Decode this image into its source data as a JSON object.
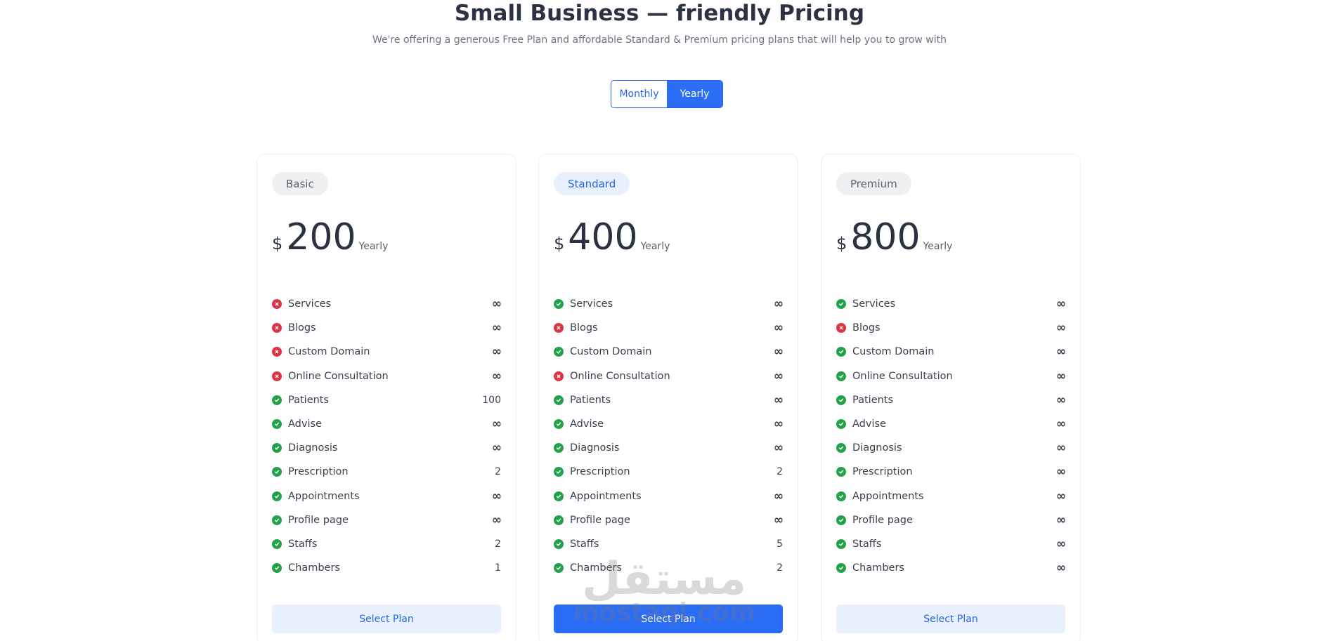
{
  "header": {
    "title": "Small Business — friendly Pricing",
    "subtitle": "We're offering a generous Free Plan and affordable Standard & Premium pricing plans that will help you to grow with"
  },
  "billing_toggle": {
    "options": [
      {
        "label": "Monthly",
        "selected": false
      },
      {
        "label": "Yearly",
        "selected": true
      }
    ]
  },
  "colors": {
    "accent": "#2b6df5",
    "check": "#22a24a",
    "cross": "#dc3545"
  },
  "icons": {
    "included": "check-circle-icon",
    "excluded": "x-circle-icon"
  },
  "plans": [
    {
      "name": "Basic",
      "currency": "$",
      "price": "200",
      "period": "Yearly",
      "button_label": "Select Plan",
      "features": [
        {
          "name": "Services",
          "included": false,
          "value": "∞"
        },
        {
          "name": "Blogs",
          "included": false,
          "value": "∞"
        },
        {
          "name": "Custom Domain",
          "included": false,
          "value": "∞"
        },
        {
          "name": "Online Consultation",
          "included": false,
          "value": "∞"
        },
        {
          "name": "Patients",
          "included": true,
          "value": "100"
        },
        {
          "name": "Advise",
          "included": true,
          "value": "∞"
        },
        {
          "name": "Diagnosis",
          "included": true,
          "value": "∞"
        },
        {
          "name": "Prescription",
          "included": true,
          "value": "2"
        },
        {
          "name": "Appointments",
          "included": true,
          "value": "∞"
        },
        {
          "name": "Profile page",
          "included": true,
          "value": "∞"
        },
        {
          "name": "Staffs",
          "included": true,
          "value": "2"
        },
        {
          "name": "Chambers",
          "included": true,
          "value": "1"
        }
      ]
    },
    {
      "name": "Standard",
      "currency": "$",
      "price": "400",
      "period": "Yearly",
      "button_label": "Select Plan",
      "features": [
        {
          "name": "Services",
          "included": true,
          "value": "∞"
        },
        {
          "name": "Blogs",
          "included": false,
          "value": "∞"
        },
        {
          "name": "Custom Domain",
          "included": true,
          "value": "∞"
        },
        {
          "name": "Online Consultation",
          "included": false,
          "value": "∞"
        },
        {
          "name": "Patients",
          "included": true,
          "value": "∞"
        },
        {
          "name": "Advise",
          "included": true,
          "value": "∞"
        },
        {
          "name": "Diagnosis",
          "included": true,
          "value": "∞"
        },
        {
          "name": "Prescription",
          "included": true,
          "value": "2"
        },
        {
          "name": "Appointments",
          "included": true,
          "value": "∞"
        },
        {
          "name": "Profile page",
          "included": true,
          "value": "∞"
        },
        {
          "name": "Staffs",
          "included": true,
          "value": "5"
        },
        {
          "name": "Chambers",
          "included": true,
          "value": "2"
        }
      ]
    },
    {
      "name": "Premium",
      "currency": "$",
      "price": "800",
      "period": "Yearly",
      "button_label": "Select Plan",
      "features": [
        {
          "name": "Services",
          "included": true,
          "value": "∞"
        },
        {
          "name": "Blogs",
          "included": false,
          "value": "∞"
        },
        {
          "name": "Custom Domain",
          "included": true,
          "value": "∞"
        },
        {
          "name": "Online Consultation",
          "included": true,
          "value": "∞"
        },
        {
          "name": "Patients",
          "included": true,
          "value": "∞"
        },
        {
          "name": "Advise",
          "included": true,
          "value": "∞"
        },
        {
          "name": "Diagnosis",
          "included": true,
          "value": "∞"
        },
        {
          "name": "Prescription",
          "included": true,
          "value": "∞"
        },
        {
          "name": "Appointments",
          "included": true,
          "value": "∞"
        },
        {
          "name": "Profile page",
          "included": true,
          "value": "∞"
        },
        {
          "name": "Staffs",
          "included": true,
          "value": "∞"
        },
        {
          "name": "Chambers",
          "included": true,
          "value": "∞"
        }
      ]
    }
  ],
  "watermark": {
    "arabic": "مستقل",
    "latin": "mostaql.com"
  }
}
